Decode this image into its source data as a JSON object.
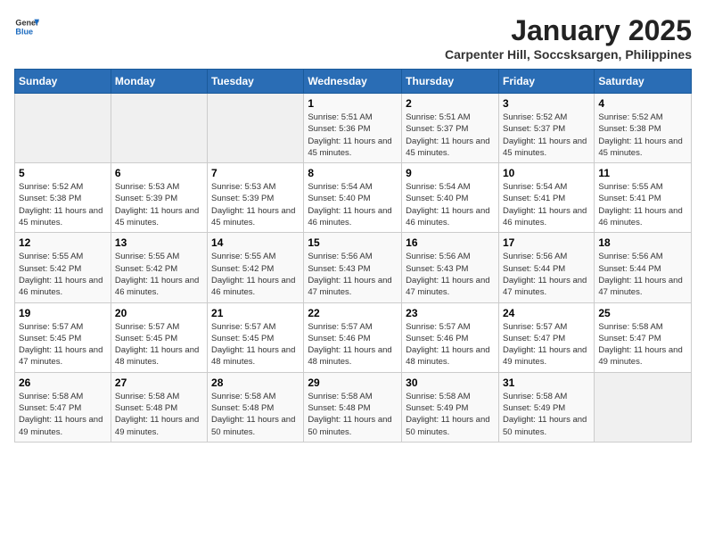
{
  "logo": {
    "general": "General",
    "blue": "Blue"
  },
  "header": {
    "title": "January 2025",
    "subtitle": "Carpenter Hill, Soccsksargen, Philippines"
  },
  "days_of_week": [
    "Sunday",
    "Monday",
    "Tuesday",
    "Wednesday",
    "Thursday",
    "Friday",
    "Saturday"
  ],
  "weeks": [
    {
      "days": [
        {
          "num": "",
          "info": ""
        },
        {
          "num": "",
          "info": ""
        },
        {
          "num": "",
          "info": ""
        },
        {
          "num": "1",
          "info": "Sunrise: 5:51 AM\nSunset: 5:36 PM\nDaylight: 11 hours and 45 minutes."
        },
        {
          "num": "2",
          "info": "Sunrise: 5:51 AM\nSunset: 5:37 PM\nDaylight: 11 hours and 45 minutes."
        },
        {
          "num": "3",
          "info": "Sunrise: 5:52 AM\nSunset: 5:37 PM\nDaylight: 11 hours and 45 minutes."
        },
        {
          "num": "4",
          "info": "Sunrise: 5:52 AM\nSunset: 5:38 PM\nDaylight: 11 hours and 45 minutes."
        }
      ]
    },
    {
      "days": [
        {
          "num": "5",
          "info": "Sunrise: 5:52 AM\nSunset: 5:38 PM\nDaylight: 11 hours and 45 minutes."
        },
        {
          "num": "6",
          "info": "Sunrise: 5:53 AM\nSunset: 5:39 PM\nDaylight: 11 hours and 45 minutes."
        },
        {
          "num": "7",
          "info": "Sunrise: 5:53 AM\nSunset: 5:39 PM\nDaylight: 11 hours and 45 minutes."
        },
        {
          "num": "8",
          "info": "Sunrise: 5:54 AM\nSunset: 5:40 PM\nDaylight: 11 hours and 46 minutes."
        },
        {
          "num": "9",
          "info": "Sunrise: 5:54 AM\nSunset: 5:40 PM\nDaylight: 11 hours and 46 minutes."
        },
        {
          "num": "10",
          "info": "Sunrise: 5:54 AM\nSunset: 5:41 PM\nDaylight: 11 hours and 46 minutes."
        },
        {
          "num": "11",
          "info": "Sunrise: 5:55 AM\nSunset: 5:41 PM\nDaylight: 11 hours and 46 minutes."
        }
      ]
    },
    {
      "days": [
        {
          "num": "12",
          "info": "Sunrise: 5:55 AM\nSunset: 5:42 PM\nDaylight: 11 hours and 46 minutes."
        },
        {
          "num": "13",
          "info": "Sunrise: 5:55 AM\nSunset: 5:42 PM\nDaylight: 11 hours and 46 minutes."
        },
        {
          "num": "14",
          "info": "Sunrise: 5:55 AM\nSunset: 5:42 PM\nDaylight: 11 hours and 46 minutes."
        },
        {
          "num": "15",
          "info": "Sunrise: 5:56 AM\nSunset: 5:43 PM\nDaylight: 11 hours and 47 minutes."
        },
        {
          "num": "16",
          "info": "Sunrise: 5:56 AM\nSunset: 5:43 PM\nDaylight: 11 hours and 47 minutes."
        },
        {
          "num": "17",
          "info": "Sunrise: 5:56 AM\nSunset: 5:44 PM\nDaylight: 11 hours and 47 minutes."
        },
        {
          "num": "18",
          "info": "Sunrise: 5:56 AM\nSunset: 5:44 PM\nDaylight: 11 hours and 47 minutes."
        }
      ]
    },
    {
      "days": [
        {
          "num": "19",
          "info": "Sunrise: 5:57 AM\nSunset: 5:45 PM\nDaylight: 11 hours and 47 minutes."
        },
        {
          "num": "20",
          "info": "Sunrise: 5:57 AM\nSunset: 5:45 PM\nDaylight: 11 hours and 48 minutes."
        },
        {
          "num": "21",
          "info": "Sunrise: 5:57 AM\nSunset: 5:45 PM\nDaylight: 11 hours and 48 minutes."
        },
        {
          "num": "22",
          "info": "Sunrise: 5:57 AM\nSunset: 5:46 PM\nDaylight: 11 hours and 48 minutes."
        },
        {
          "num": "23",
          "info": "Sunrise: 5:57 AM\nSunset: 5:46 PM\nDaylight: 11 hours and 48 minutes."
        },
        {
          "num": "24",
          "info": "Sunrise: 5:57 AM\nSunset: 5:47 PM\nDaylight: 11 hours and 49 minutes."
        },
        {
          "num": "25",
          "info": "Sunrise: 5:58 AM\nSunset: 5:47 PM\nDaylight: 11 hours and 49 minutes."
        }
      ]
    },
    {
      "days": [
        {
          "num": "26",
          "info": "Sunrise: 5:58 AM\nSunset: 5:47 PM\nDaylight: 11 hours and 49 minutes."
        },
        {
          "num": "27",
          "info": "Sunrise: 5:58 AM\nSunset: 5:48 PM\nDaylight: 11 hours and 49 minutes."
        },
        {
          "num": "28",
          "info": "Sunrise: 5:58 AM\nSunset: 5:48 PM\nDaylight: 11 hours and 50 minutes."
        },
        {
          "num": "29",
          "info": "Sunrise: 5:58 AM\nSunset: 5:48 PM\nDaylight: 11 hours and 50 minutes."
        },
        {
          "num": "30",
          "info": "Sunrise: 5:58 AM\nSunset: 5:49 PM\nDaylight: 11 hours and 50 minutes."
        },
        {
          "num": "31",
          "info": "Sunrise: 5:58 AM\nSunset: 5:49 PM\nDaylight: 11 hours and 50 minutes."
        },
        {
          "num": "",
          "info": ""
        }
      ]
    }
  ]
}
